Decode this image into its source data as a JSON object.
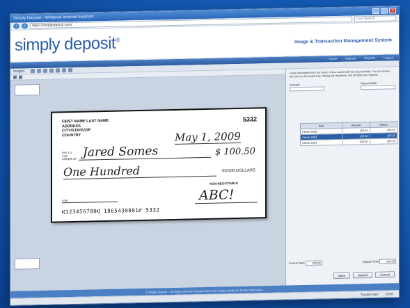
{
  "window": {
    "title": "Simply Deposit - Windows Internet Explorer",
    "url": "https://simplydeposit.com/",
    "search_placeholder": "Live Search"
  },
  "header": {
    "logo": "simply deposit",
    "system_title": "Image & Transaction Management System"
  },
  "navbar": {
    "items": [
      "Home",
      "Deposit",
      "Reports",
      "Logout"
    ]
  },
  "toolbar": {
    "label": "Images"
  },
  "check": {
    "name_block": [
      "FIRST NAME LAST NAME",
      "ADDRESS",
      "CITY/STATE/ZIP",
      "COUNTRY"
    ],
    "number": "5332",
    "date": "May 1, 2009",
    "pay_label": "PAY TO THE ORDER OF",
    "payee": "Jared Somes",
    "amount": "$ 100.50",
    "written_amount": "One Hundred",
    "cents_fraction": "50/100",
    "dollars_label": "DOLLARS",
    "non_negotiable": "NON-NEGOTIABLE",
    "memo_label": "FOR",
    "signature": "ABC!",
    "micr": "⑆123456780⑆ 1865430001⑈ 5332"
  },
  "right_panel": {
    "note": "Enter information from the check. Press submit with the required data. You can review the items in this deposit by clicking the thumbnail. Not all fields are required.",
    "fields": [
      {
        "label": "Account"
      },
      {
        "label": "Deposit Date"
      }
    ],
    "table": {
      "headers": [
        "Item",
        "Amount",
        "Status"
      ],
      "rows": [
        {
          "item": "Check 5332",
          "amount": "100.50",
          "status": "100.50",
          "selected": false
        },
        {
          "item": "Check 5333",
          "amount": "100.50",
          "status": "100.50",
          "selected": true
        },
        {
          "item": "Check 5334",
          "amount": "100.50",
          "status": "100.50",
          "selected": false
        }
      ]
    },
    "totals": {
      "control_label": "Control Total",
      "control_value": "100.50",
      "deposit_label": "Deposit Total",
      "deposit_value": "100.50"
    },
    "buttons": [
      "Save",
      "Submit",
      "Cancel"
    ]
  },
  "footer": {
    "text": "© Simply Deposit – All rights reserved. Please refer to the contact details for further information."
  },
  "status": {
    "zone": "Trusted sites",
    "zoom": "100%"
  }
}
